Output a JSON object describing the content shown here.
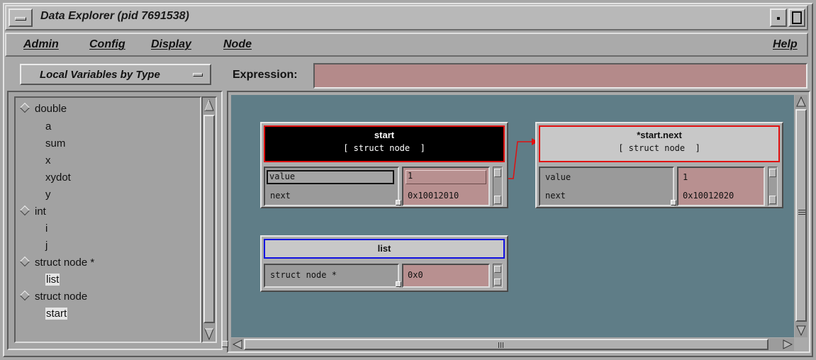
{
  "window": {
    "title": "Data Explorer (pid 7691538)"
  },
  "menu": {
    "admin": "Admin",
    "config": "Config",
    "display": "Display",
    "node": "Node",
    "help": "Help"
  },
  "left_panel": {
    "selector_label": "Local Variables by Type",
    "tree": [
      {
        "type": "group",
        "label": "double"
      },
      {
        "type": "item",
        "label": "a"
      },
      {
        "type": "item",
        "label": "sum"
      },
      {
        "type": "item",
        "label": "x"
      },
      {
        "type": "item",
        "label": "xydot"
      },
      {
        "type": "item",
        "label": "y"
      },
      {
        "type": "group",
        "label": "int"
      },
      {
        "type": "item",
        "label": "i"
      },
      {
        "type": "item",
        "label": "j"
      },
      {
        "type": "group",
        "label": "struct node *"
      },
      {
        "type": "item",
        "label": "list"
      },
      {
        "type": "group",
        "label": "struct node"
      },
      {
        "type": "item",
        "label": "start"
      }
    ]
  },
  "expression": {
    "label": "Expression:",
    "value": ""
  },
  "nodes": {
    "start": {
      "name": "start",
      "type": "[ struct node  ]",
      "fields": [
        {
          "name": "value",
          "value": "1"
        },
        {
          "name": "next",
          "value": "0x10012010"
        }
      ]
    },
    "start_next": {
      "name": "*start.next",
      "type": "[ struct node  ]",
      "fields": [
        {
          "name": "value",
          "value": "1"
        },
        {
          "name": "next",
          "value": "0x10012020"
        }
      ]
    },
    "list": {
      "name": "list",
      "fields": [
        {
          "name": "struct node *",
          "value": "0x0"
        }
      ]
    }
  },
  "colors": {
    "canvas": "#5f7d87",
    "value_field": "#b89090",
    "expression_field": "#b48a8a",
    "start_header": "#000000",
    "start_border": "#e01010",
    "next_border": "#e01010",
    "list_border": "#1010e0",
    "link_arrow": "#e01010"
  }
}
